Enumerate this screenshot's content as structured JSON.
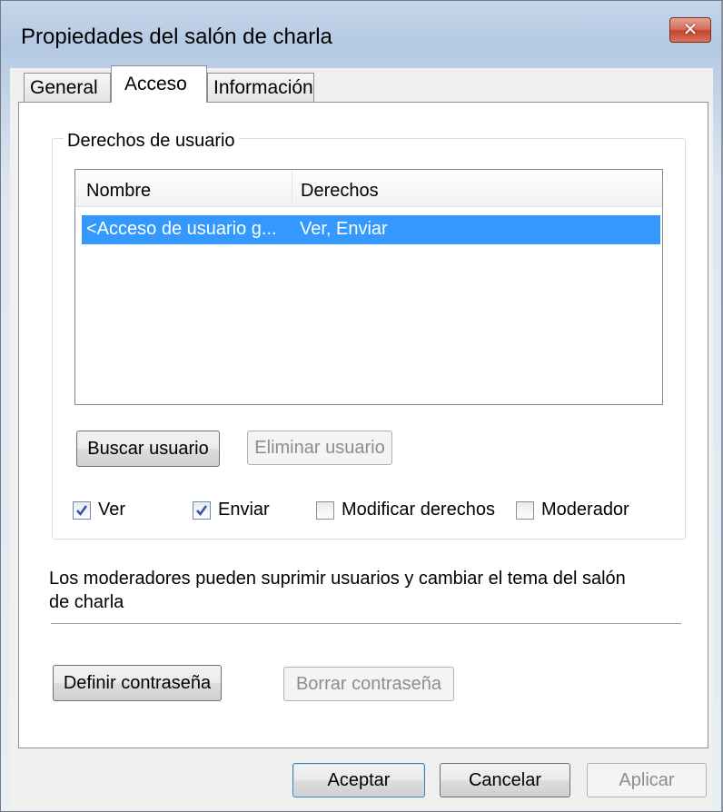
{
  "window": {
    "title": "Propiedades del salón de charla",
    "close_label": "✕"
  },
  "tabs": [
    {
      "label": "General",
      "active": false
    },
    {
      "label": "Acceso",
      "active": true
    },
    {
      "label": "Información",
      "active": false
    }
  ],
  "user_rights": {
    "group_label": "Derechos de usuario",
    "columns": [
      "Nombre",
      "Derechos"
    ],
    "rows": [
      {
        "name": "<Acceso de usuario g...",
        "rights": "Ver, Enviar",
        "selected": true
      }
    ],
    "buttons": {
      "search_user": "Buscar usuario",
      "remove_user": "Eliminar usuario"
    },
    "checkboxes": [
      {
        "label": "Ver",
        "checked": true
      },
      {
        "label": "Enviar",
        "checked": true
      },
      {
        "label": "Modificar derechos",
        "checked": false
      },
      {
        "label": "Moderador",
        "checked": false
      }
    ]
  },
  "info_text": {
    "line1": "Los moderadores pueden suprimir usuarios y cambiar el tema del salón",
    "line2": "de charla"
  },
  "password_buttons": {
    "set": "Definir contraseña",
    "clear": "Borrar contraseña"
  },
  "dialog_buttons": {
    "ok": "Aceptar",
    "cancel": "Cancelar",
    "apply": "Aplicar"
  },
  "colors": {
    "selection": "#3399ff",
    "close_button": "#c4452f"
  }
}
